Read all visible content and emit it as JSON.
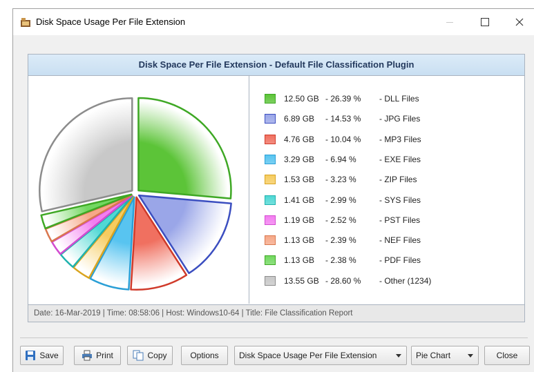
{
  "window": {
    "title": "Disk Space Usage Per File Extension"
  },
  "report": {
    "header": "Disk Space Per File Extension - Default File Classification Plugin",
    "footer": "Date: 16-Mar-2019 | Time: 08:58:06 | Host: Windows10-64 | Title: File Classification Report",
    "legend": [
      {
        "size": "12.50 GB",
        "pct": "- 26.39 %",
        "name": "- DLL Files",
        "color": "#5cc438",
        "border": "#3ea824"
      },
      {
        "size": "6.89 GB",
        "pct": "- 14.53 %",
        "name": "- JPG Files",
        "color": "#9aa6e8",
        "border": "#3b4ec0"
      },
      {
        "size": "4.76 GB",
        "pct": "- 10.04 %",
        "name": "- MP3 Files",
        "color": "#f07060",
        "border": "#d03a2a"
      },
      {
        "size": "3.29 GB",
        "pct": "- 6.94 %",
        "name": "- EXE Files",
        "color": "#58c4f0",
        "border": "#2a9fd6"
      },
      {
        "size": "1.53 GB",
        "pct": "- 3.23 %",
        "name": "- ZIP Files",
        "color": "#f6cc60",
        "border": "#d9a420"
      },
      {
        "size": "1.41 GB",
        "pct": "- 2.99 %",
        "name": "- SYS Files",
        "color": "#50d8d4",
        "border": "#1fb2ae"
      },
      {
        "size": "1.19 GB",
        "pct": "- 2.52 %",
        "name": "- PST Files",
        "color": "#f37ef0",
        "border": "#d24bd0"
      },
      {
        "size": "1.13 GB",
        "pct": "- 2.39 %",
        "name": "- NEF Files",
        "color": "#f6a888",
        "border": "#d9774e"
      },
      {
        "size": "1.13 GB",
        "pct": "- 2.38 %",
        "name": "- PDF Files",
        "color": "#72d860",
        "border": "#3ea824"
      },
      {
        "size": "13.55 GB",
        "pct": "- 28.60 %",
        "name": "- Other (1234)",
        "color": "#c8c8c8",
        "border": "#8c8c8c"
      }
    ]
  },
  "chart_data": {
    "type": "pie",
    "categories": [
      "DLL Files",
      "JPG Files",
      "MP3 Files",
      "EXE Files",
      "ZIP Files",
      "SYS Files",
      "PST Files",
      "NEF Files",
      "PDF Files",
      "Other (1234)"
    ],
    "values": [
      26.39,
      14.53,
      10.04,
      6.94,
      3.23,
      2.99,
      2.52,
      2.39,
      2.38,
      28.6
    ],
    "sizes_gb": [
      12.5,
      6.89,
      4.76,
      3.29,
      1.53,
      1.41,
      1.19,
      1.13,
      1.13,
      13.55
    ],
    "exploded": true,
    "legend": "right"
  },
  "toolbar": {
    "save": "Save",
    "print": "Print",
    "copy": "Copy",
    "options": "Options",
    "report_select": "Disk Space Usage Per File Extension",
    "chart_select": "Pie Chart",
    "close": "Close"
  }
}
